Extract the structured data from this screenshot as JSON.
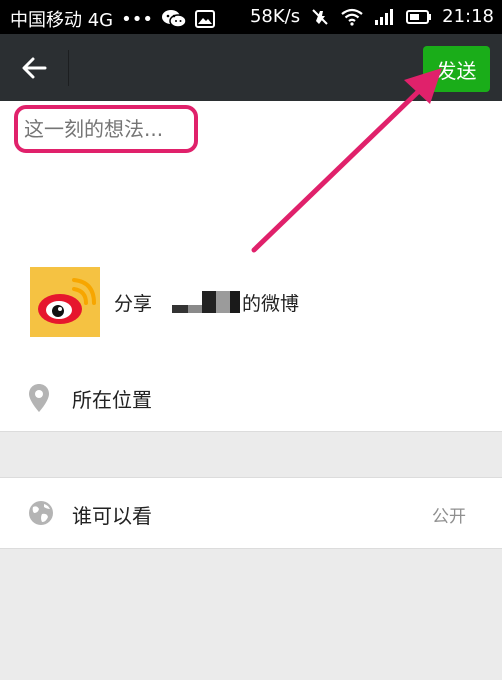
{
  "status_bar": {
    "carrier": "中国移动 4G",
    "dots": "•••",
    "speed": "58K/s",
    "time": "21:18"
  },
  "app_bar": {
    "send_label": "发送"
  },
  "compose": {
    "placeholder": "这一刻的想法..."
  },
  "share": {
    "text_prefix": "分享",
    "text_suffix": "的微博"
  },
  "location": {
    "label": "所在位置"
  },
  "visibility": {
    "label": "谁可以看",
    "value": "公开"
  },
  "colors": {
    "send_button": "#1aad19",
    "app_bar": "#2b2f32",
    "highlight": "#e0216b",
    "background": "#ebebeb"
  },
  "icons": [
    "back-arrow-icon",
    "wechat-icon",
    "image-icon",
    "mute-icon",
    "wifi-icon",
    "signal-icon",
    "battery-icon",
    "weibo-icon",
    "location-pin-icon",
    "globe-icon"
  ]
}
